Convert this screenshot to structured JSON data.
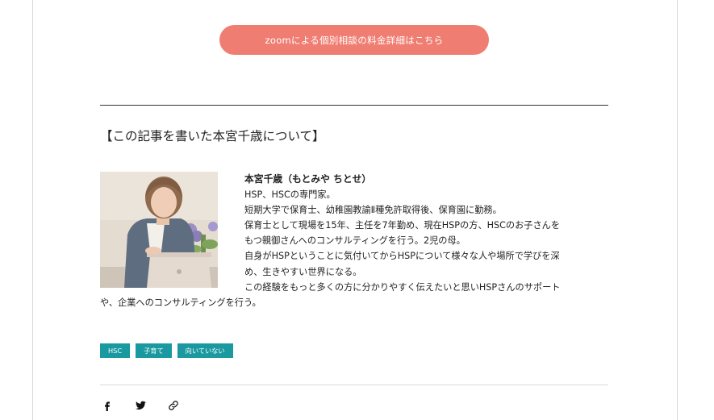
{
  "cta": {
    "label": "zoomによる個別相談の料金詳細はこちら",
    "color": "#ef7d72"
  },
  "author_section": {
    "heading": "【この記事を書いた本宮千歳について】",
    "photo_icon": "author-photo",
    "bio": {
      "name": "本宮千歳（もとみや ちとせ）",
      "lines": [
        "HSP、HSCの専門家。",
        "短期大学で保育士、幼稚園教諭Ⅱ種免許取得後、保育園に勤務。",
        "保育士として現場を15年、主任を7年勤め、現在HSPの方、HSCのお子さんを",
        "もつ親御さんへのコンサルティングを行う。2児の母。",
        "自身がHSPということに気付いてからHSPについて様々な人や場所で学びを深",
        "め、生きやすい世界になる。",
        "この経験をもっと多くの方に分かりやすく伝えたいと思いHSPさんのサポート",
        "や、企業へのコンサルティングを行う。"
      ]
    }
  },
  "tags": {
    "items": [
      "HSC",
      "子育て",
      "向いていない"
    ],
    "color": "#1a9aa0"
  },
  "share": {
    "icons": [
      "facebook-icon",
      "twitter-icon",
      "link-icon"
    ]
  }
}
